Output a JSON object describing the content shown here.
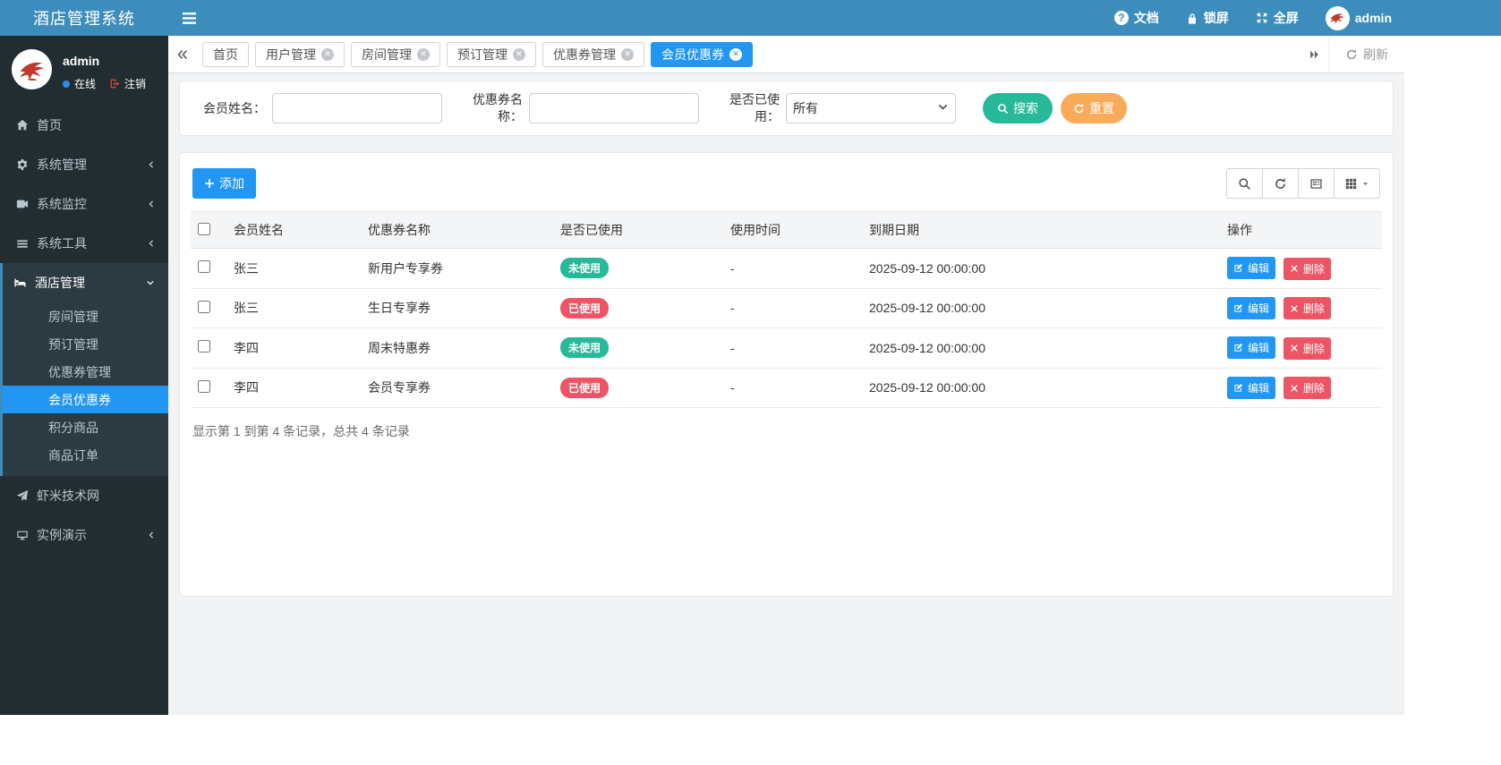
{
  "app": {
    "title": "酒店管理系统"
  },
  "topbar": {
    "docs": "文档",
    "lock": "锁屏",
    "fullscreen": "全屏",
    "username": "admin"
  },
  "sidebar": {
    "username": "admin",
    "status": "在线",
    "logout": "注销",
    "items": {
      "home": "首页",
      "system_mgmt": "系统管理",
      "system_monitor": "系统监控",
      "system_tools": "系统工具",
      "hotel_mgmt": "酒店管理",
      "xiami": "虾米技术网",
      "demo": "实例演示"
    },
    "hotel_children": {
      "room": "房间管理",
      "booking": "预订管理",
      "coupon": "优惠券管理",
      "member_coupon": "会员优惠券",
      "points_goods": "积分商品",
      "goods_order": "商品订单"
    }
  },
  "tabs": {
    "home": "首页",
    "user": "用户管理",
    "room": "房间管理",
    "booking": "预订管理",
    "coupon": "优惠券管理",
    "member_coupon": "会员优惠券",
    "refresh": "刷新"
  },
  "search": {
    "member_label": "会员姓名：",
    "coupon_label": "优惠券名称：",
    "used_label": "是否已使用：",
    "used_value": "所有",
    "search_btn": "搜索",
    "reset_btn": "重置"
  },
  "toolbar": {
    "add": "添加"
  },
  "table": {
    "headers": {
      "member": "会员姓名",
      "coupon": "优惠券名称",
      "used": "是否已使用",
      "use_time": "使用时间",
      "expire": "到期日期",
      "actions": "操作"
    },
    "rows": [
      {
        "member": "张三",
        "coupon": "新用户专享券",
        "used": "未使用",
        "use_time": "-",
        "expire": "2025-09-12 00:00:00"
      },
      {
        "member": "张三",
        "coupon": "生日专享券",
        "used": "已使用",
        "use_time": "-",
        "expire": "2025-09-12 00:00:00"
      },
      {
        "member": "李四",
        "coupon": "周末特惠券",
        "used": "未使用",
        "use_time": "-",
        "expire": "2025-09-12 00:00:00"
      },
      {
        "member": "李四",
        "coupon": "会员专享券",
        "used": "已使用",
        "use_time": "-",
        "expire": "2025-09-12 00:00:00"
      }
    ],
    "edit": "编辑",
    "delete": "删除",
    "summary": "显示第 1 到第 4 条记录，总共 4 条记录"
  },
  "colors": {
    "navbar": "#3c8dbc",
    "sidebar": "#222d32",
    "primary": "#2196f3",
    "green": "#26b99a",
    "orange": "#f8ac59",
    "red": "#ed5565"
  }
}
